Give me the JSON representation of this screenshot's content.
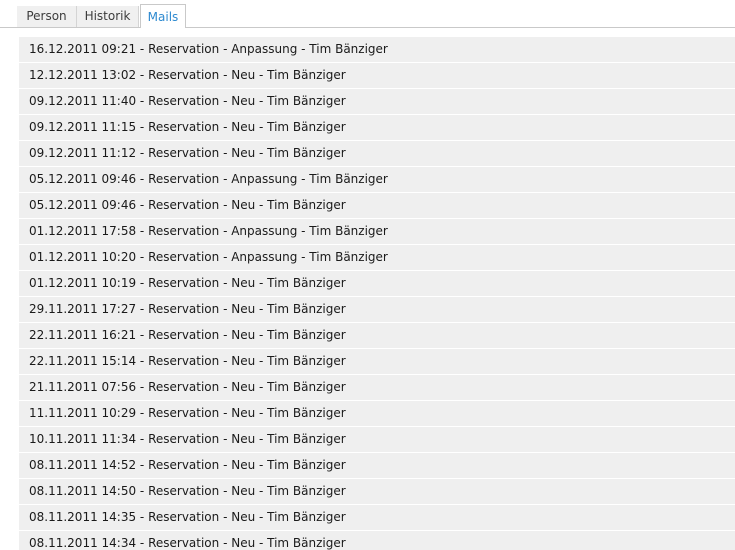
{
  "tabs": [
    {
      "label": "Person",
      "active": false
    },
    {
      "label": "Historik",
      "active": false
    },
    {
      "label": "Mails",
      "active": true
    }
  ],
  "colors": {
    "active_tab_text": "#2e8ad0",
    "row_background": "#efefef",
    "text": "#1a1a1a"
  },
  "mails": [
    "16.12.2011 09:21 - Reservation - Anpassung - Tim Bänziger",
    "12.12.2011 13:02 - Reservation - Neu - Tim Bänziger",
    "09.12.2011 11:40 - Reservation - Neu - Tim Bänziger",
    "09.12.2011 11:15 - Reservation - Neu - Tim Bänziger",
    "09.12.2011 11:12 - Reservation - Neu - Tim Bänziger",
    "05.12.2011 09:46 - Reservation - Anpassung - Tim Bänziger",
    "05.12.2011 09:46 - Reservation - Neu - Tim Bänziger",
    "01.12.2011 17:58 - Reservation - Anpassung - Tim Bänziger",
    "01.12.2011 10:20 - Reservation - Anpassung - Tim Bänziger",
    "01.12.2011 10:19 - Reservation - Neu - Tim Bänziger",
    "29.11.2011 17:27 - Reservation - Neu - Tim Bänziger",
    "22.11.2011 16:21 - Reservation - Neu - Tim Bänziger",
    "22.11.2011 15:14 - Reservation - Neu - Tim Bänziger",
    "21.11.2011 07:56 - Reservation - Neu - Tim Bänziger",
    "11.11.2011 10:29 - Reservation - Neu - Tim Bänziger",
    "10.11.2011 11:34 - Reservation - Neu - Tim Bänziger",
    "08.11.2011 14:52 - Reservation - Neu - Tim Bänziger",
    "08.11.2011 14:50 - Reservation - Neu - Tim Bänziger",
    "08.11.2011 14:35 - Reservation - Neu - Tim Bänziger",
    "08.11.2011 14:34 - Reservation - Neu - Tim Bänziger"
  ]
}
